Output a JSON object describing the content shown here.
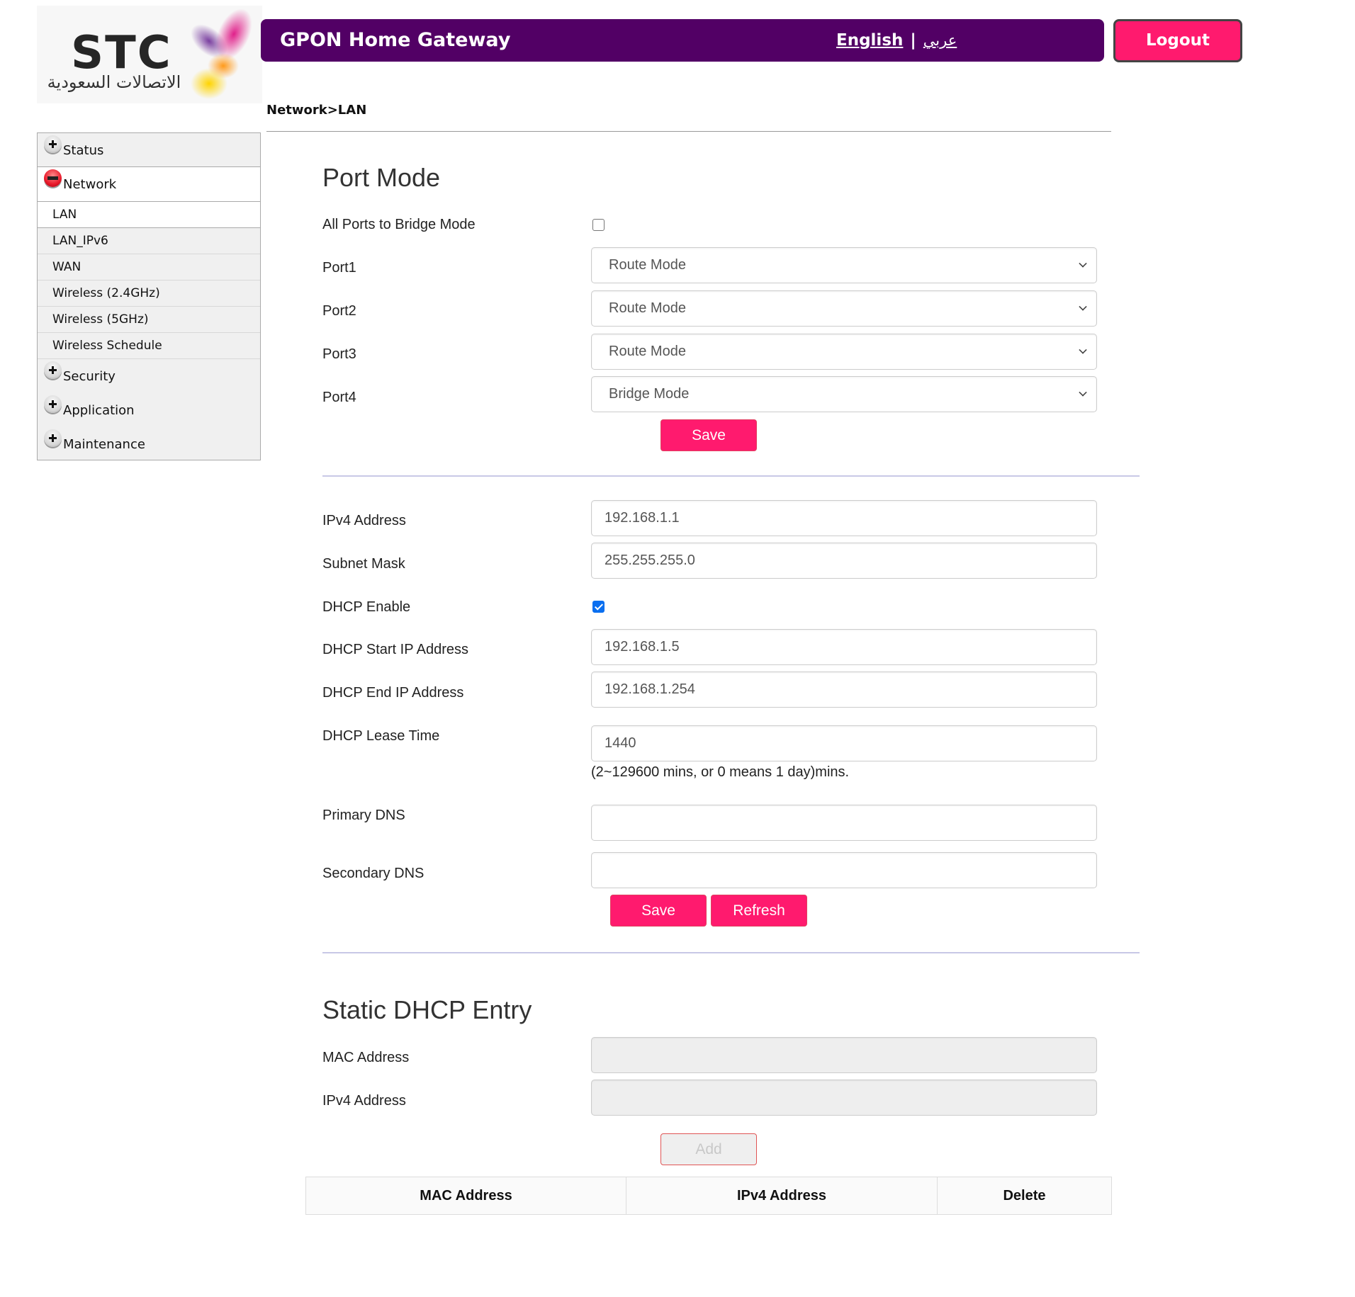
{
  "logo": {
    "brand": "STC",
    "arabic_name": "الاتصالات السعودية"
  },
  "header": {
    "title": "GPON Home Gateway",
    "lang_english": "English",
    "lang_separator": "|",
    "lang_arabic": "عربي",
    "logout_label": "Logout"
  },
  "breadcrumb": "Network>LAN",
  "sidebar": {
    "status": "Status",
    "network": "Network",
    "network_items": [
      "LAN",
      "LAN_IPv6",
      "WAN",
      "Wireless (2.4GHz)",
      "Wireless (5GHz)",
      "Wireless Schedule"
    ],
    "active_item": "LAN",
    "security": "Security",
    "application": "Application",
    "maintenance": "Maintenance"
  },
  "port_mode": {
    "title": "Port Mode",
    "all_bridge_label": "All Ports to Bridge Mode",
    "all_bridge_checked": false,
    "ports": [
      {
        "label": "Port1",
        "value": "Route Mode"
      },
      {
        "label": "Port2",
        "value": "Route Mode"
      },
      {
        "label": "Port3",
        "value": "Route Mode"
      },
      {
        "label": "Port4",
        "value": "Bridge Mode"
      }
    ],
    "save_label": "Save"
  },
  "lan": {
    "ipv4_label": "IPv4 Address",
    "ipv4_value": "192.168.1.1",
    "subnet_label": "Subnet Mask",
    "subnet_value": "255.255.255.0",
    "dhcp_enable_label": "DHCP Enable",
    "dhcp_enabled": true,
    "dhcp_start_label": "DHCP Start IP Address",
    "dhcp_start_value": "192.168.1.5",
    "dhcp_end_label": "DHCP End IP Address",
    "dhcp_end_value": "192.168.1.254",
    "lease_label": "DHCP Lease Time",
    "lease_value": "1440",
    "lease_hint": "(2~129600 mins, or 0 means 1 day)mins.",
    "primary_dns_label": "Primary DNS",
    "primary_dns_value": "",
    "secondary_dns_label": "Secondary DNS",
    "secondary_dns_value": "",
    "save_label": "Save",
    "refresh_label": "Refresh"
  },
  "static_dhcp": {
    "title": "Static DHCP Entry",
    "mac_label": "MAC Address",
    "mac_value": "",
    "ipv4_label": "IPv4 Address",
    "ipv4_value": "",
    "add_label": "Add",
    "table_headers": [
      "MAC Address",
      "IPv4 Address",
      "Delete"
    ],
    "rows": []
  },
  "colors": {
    "header_bg": "#520065",
    "accent": "#ff1a6e",
    "checkbox_checked": "#0a6ff0"
  }
}
